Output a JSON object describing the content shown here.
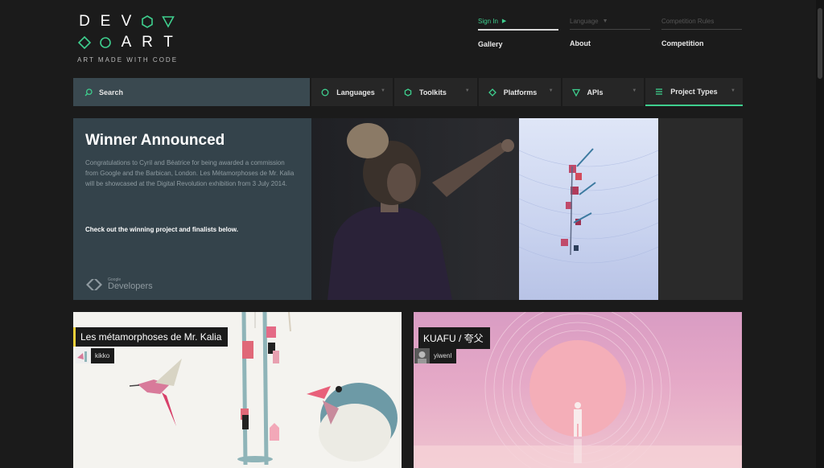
{
  "logo": {
    "row1": [
      "D",
      "E",
      "V"
    ],
    "row2": [
      "A",
      "R",
      "T"
    ],
    "tagline": "ART MADE WITH CODE",
    "accent_color": "#3ecf8e"
  },
  "topnav": [
    {
      "top": "Sign In",
      "bottom": "Gallery",
      "active": true,
      "icon": "play-caret-icon"
    },
    {
      "top": "Language",
      "bottom": "About",
      "active": false,
      "icon": "chevron-down-icon"
    },
    {
      "top": "Competition Rules",
      "bottom": "Competition",
      "active": false
    }
  ],
  "filterbar": {
    "search_label": "Search",
    "filters": [
      {
        "label": "Languages",
        "icon": "circle-icon"
      },
      {
        "label": "Toolkits",
        "icon": "hexagon-icon"
      },
      {
        "label": "Platforms",
        "icon": "diamond-icon"
      },
      {
        "label": "APIs",
        "icon": "triangle-icon"
      },
      {
        "label": "Project Types",
        "icon": "lines-icon"
      }
    ]
  },
  "hero": {
    "title": "Winner Announced",
    "description": "Congratulations to Cyril and Béatrice for being awarded a commission from Google and the Barbican, London. Les Métamorphoses de Mr. Kalia will be showcased at the Digital Revolution exhibition from 3 July 2014.",
    "cta": "Check out the winning project and finalists below.",
    "sponsor_small": "Google",
    "sponsor_big": "Developers"
  },
  "cards": [
    {
      "title": "Les métamorphoses de Mr. Kalia",
      "user": "kikko"
    },
    {
      "title": "KUAFU / 夸父",
      "user": "yiwenl"
    }
  ]
}
